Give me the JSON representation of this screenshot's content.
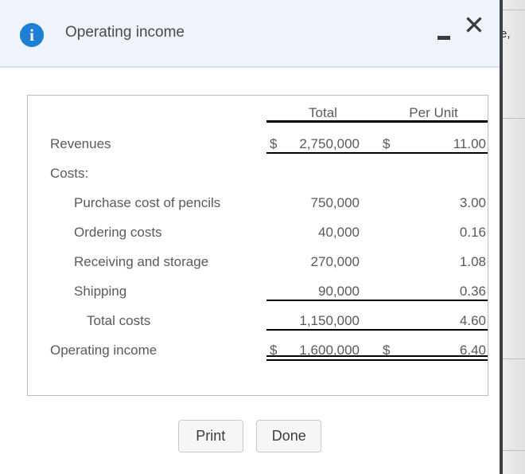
{
  "dialog": {
    "title": "Operating income",
    "info_icon": "info-icon",
    "minimize_label": "",
    "close_label": "✕"
  },
  "backdrop": {
    "fragment_text": "e,"
  },
  "report": {
    "columns": [
      "",
      "Total",
      "Per Unit"
    ],
    "rows": [
      {
        "label": "Revenues",
        "indent": 0,
        "total_symbol": "$",
        "total": "2,750,000",
        "unit_symbol": "$",
        "unit": "11.00",
        "rule_top": true,
        "rule_bottom": true,
        "rule_double": false
      },
      {
        "label": "Costs:",
        "indent": 0,
        "total_symbol": "",
        "total": "",
        "unit_symbol": "",
        "unit": "",
        "rule_top": false,
        "rule_bottom": false,
        "rule_double": false
      },
      {
        "label": "Purchase cost of pencils",
        "indent": 1,
        "total_symbol": "",
        "total": "750,000",
        "unit_symbol": "",
        "unit": "3.00",
        "rule_top": false,
        "rule_bottom": false,
        "rule_double": false
      },
      {
        "label": "Ordering costs",
        "indent": 1,
        "total_symbol": "",
        "total": "40,000",
        "unit_symbol": "",
        "unit": "0.16",
        "rule_top": false,
        "rule_bottom": false,
        "rule_double": false
      },
      {
        "label": "Receiving and storage",
        "indent": 1,
        "total_symbol": "",
        "total": "270,000",
        "unit_symbol": "",
        "unit": "1.08",
        "rule_top": false,
        "rule_bottom": false,
        "rule_double": false
      },
      {
        "label": "Shipping",
        "indent": 1,
        "total_symbol": "",
        "total": "90,000",
        "unit_symbol": "",
        "unit": "0.36",
        "rule_top": false,
        "rule_bottom": true,
        "rule_double": false
      },
      {
        "label": "Total costs",
        "indent": 2,
        "total_symbol": "",
        "total": "1,150,000",
        "unit_symbol": "",
        "unit": "4.60",
        "rule_top": false,
        "rule_bottom": true,
        "rule_double": false
      },
      {
        "label": "Operating income",
        "indent": 0,
        "total_symbol": "$",
        "total": "1,600,000",
        "unit_symbol": "$",
        "unit": "6.40",
        "rule_top": false,
        "rule_bottom": false,
        "rule_double": true
      }
    ]
  },
  "footer": {
    "print_label": "Print",
    "done_label": "Done"
  },
  "colors": {
    "header_background": "#eef3fc",
    "header_border": "#cfe3f5",
    "info_icon": "#1e80d4",
    "text": "#5a5a5a",
    "rule": "#000000",
    "card_border": "#bdbdbd",
    "button_face": "#f6f6f6",
    "button_border": "#c9c9c9"
  }
}
